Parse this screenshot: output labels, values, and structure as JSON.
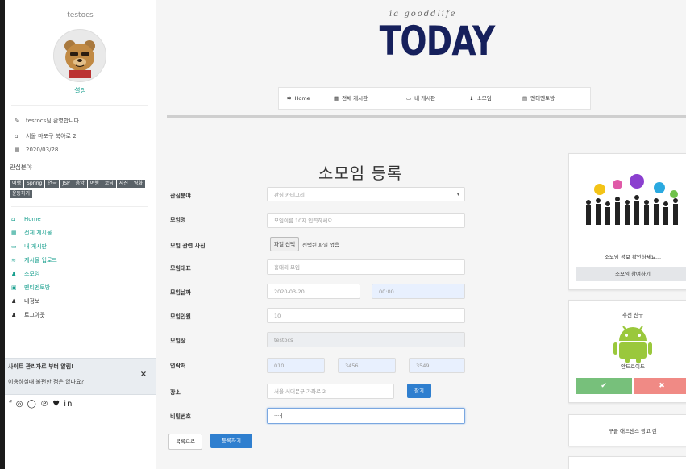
{
  "sidebar": {
    "username": "testocs",
    "settings_label": "설정",
    "info": [
      {
        "icon": "pencil-icon",
        "glyph": "✎",
        "text": "testocs님 환영합니다"
      },
      {
        "icon": "home-icon",
        "glyph": "⌂",
        "text": "서울 마포구 북아로 2"
      },
      {
        "icon": "calendar-icon",
        "glyph": "▦",
        "text": "2020/03/28"
      }
    ],
    "interest_title": "관심분야",
    "tags": [
      "여행",
      "Spring",
      "연극",
      "JSP",
      "음악",
      "여행",
      "코딩",
      "사진",
      "영화",
      "운동하기"
    ],
    "nav": [
      {
        "name": "home",
        "icon": "home-icon",
        "glyph": "⌂",
        "label": "Home",
        "dark": false
      },
      {
        "name": "all-posts",
        "icon": "grid-icon",
        "glyph": "▦",
        "label": "전체 게시물",
        "dark": false
      },
      {
        "name": "my-posts",
        "icon": "image-icon",
        "glyph": "▭",
        "label": "내 게시판",
        "dark": false
      },
      {
        "name": "upload-post",
        "icon": "wifi-icon",
        "glyph": "≋",
        "label": "게시물 업로드",
        "dark": false
      },
      {
        "name": "small-group",
        "icon": "user-icon",
        "glyph": "♟",
        "label": "소모임",
        "dark": false
      },
      {
        "name": "mentoring",
        "icon": "calendar-icon",
        "glyph": "▣",
        "label": "멘티멘토방",
        "dark": false
      },
      {
        "name": "my-info",
        "icon": "user-icon",
        "glyph": "♟",
        "label": "내정보",
        "dark": true
      },
      {
        "name": "logout",
        "icon": "user-icon",
        "glyph": "♟",
        "label": "로그아웃",
        "dark": true
      }
    ],
    "alert": {
      "line1": "사이트 관리자로 부터 알림!",
      "line2": "이용하실때 불편한 점은 없나요?",
      "close": "×"
    },
    "social_icons": [
      "facebook-icon",
      "instagram-icon",
      "github-icon",
      "pinterest-icon",
      "twitter-icon",
      "linkedin-icon"
    ],
    "social_text": "f ◎ ◯ ℗ ♥ in"
  },
  "header": {
    "script_text": "ia gooddlife",
    "logo": "TODAY",
    "nav": [
      {
        "name": "home",
        "icon": "home-icon",
        "glyph": "✱",
        "label": "Home"
      },
      {
        "name": "all-posts",
        "icon": "grid-icon",
        "glyph": "▦",
        "label": "전체 게시판"
      },
      {
        "name": "my-posts",
        "icon": "image-icon",
        "glyph": "▭",
        "label": "내 게시판"
      },
      {
        "name": "small-group",
        "icon": "group-icon",
        "glyph": "♝",
        "label": "소모임"
      },
      {
        "name": "mentoring",
        "icon": "table-icon",
        "glyph": "▤",
        "label": "멘티멘토방"
      }
    ]
  },
  "form": {
    "title": "소모임 등록",
    "labels": {
      "interest": "관심분야",
      "group_name": "모임명",
      "photo": "모임 관련 사진",
      "leader": "모임대표",
      "date": "모임날짜",
      "members": "모임인원",
      "group_id": "모임장",
      "contact": "연락처",
      "address": "장소",
      "password": "비밀번호"
    },
    "interest_value": "관심 카테고리",
    "group_name_placeholder": "모임이름 10자 입력하세요...",
    "file_button": "파일 선택",
    "file_status": "선택된 파일 없음",
    "leader_value": "홍대리 모임",
    "date_value": "2020-03-20",
    "time_value": "00:00",
    "members_value": "10",
    "group_id_value": "testocs",
    "phone": [
      "010",
      "3456",
      "3549"
    ],
    "address_value": "서울 서대문구 가좌로 2",
    "address_button": "찾기",
    "password_value": "····|",
    "back_button": "목록으로",
    "submit_button": "등록하기"
  },
  "cards": {
    "group": {
      "caption": "소모임 정보 확인하세요...",
      "button": "소모임 참여하기"
    },
    "friends": {
      "title": "추천 친구",
      "name": "안드로이드",
      "ok": "✔",
      "no": "✖"
    },
    "ad": {
      "text": "구글 애드센스 광고 란"
    }
  },
  "colors": {
    "teal": "#1aa08f",
    "navy": "#16205c",
    "blue_button": "#2f7fcf",
    "accept_green": "#77c07b",
    "reject_red": "#f08a85",
    "android_green": "#9ac83c"
  }
}
